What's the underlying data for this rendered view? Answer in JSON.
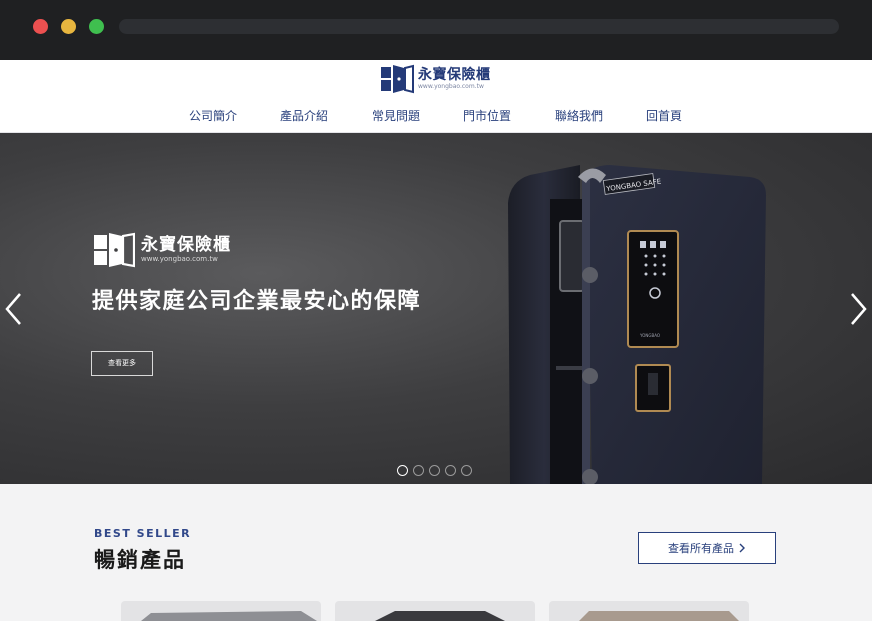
{
  "site": {
    "brand_name": "永寶保險櫃",
    "brand_url": "www.yongbao.com.tw"
  },
  "nav": {
    "items": [
      "公司簡介",
      "產品介紹",
      "常見問題",
      "門市位置",
      "聯絡我們",
      "回首頁"
    ]
  },
  "hero": {
    "brand_name": "永寶保險櫃",
    "brand_url": "www.yongbao.com.tw",
    "headline": "提供家庭公司企業最安心的保障",
    "cta_label": "查看更多",
    "safe_label": "YONGBAO SAFE",
    "keypad_label": "YONGBAO",
    "slide_count": 5,
    "active_slide": 1
  },
  "best_seller": {
    "eyebrow": "BEST SELLER",
    "title": "暢銷產品",
    "view_all_label": "查看所有產品"
  },
  "colors": {
    "brand_navy": "#243a78",
    "chrome_bg": "#1f2022",
    "hero_bg": "#3e3e40"
  }
}
